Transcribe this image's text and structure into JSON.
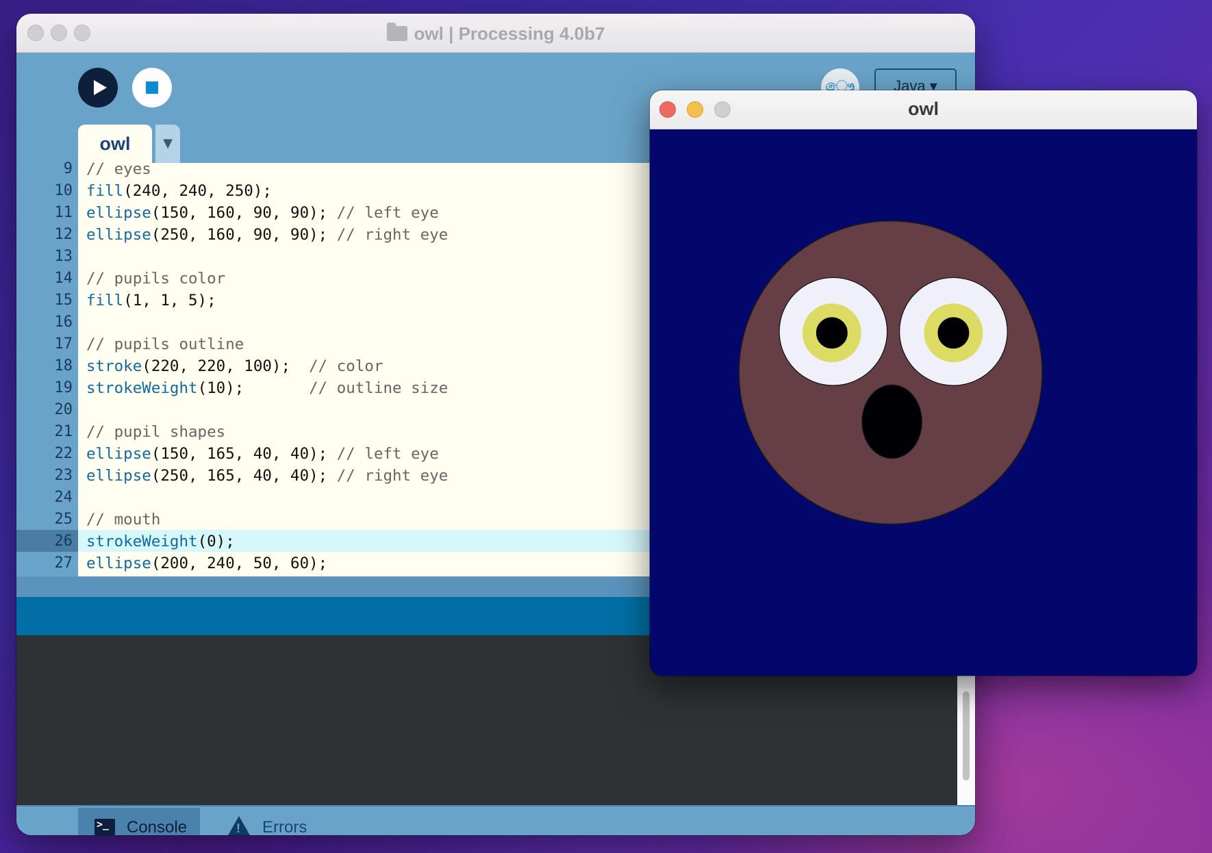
{
  "ide": {
    "title": "owl | Processing 4.0b7",
    "mode_icon": "ෞ",
    "mode_label": "Java ▾",
    "tab_label": "owl",
    "tab_menu_glyph": "▼",
    "lines": [
      {
        "n": "9",
        "tokens": [
          {
            "t": "// eyes",
            "k": "cm"
          }
        ]
      },
      {
        "n": "10",
        "tokens": [
          {
            "t": "fill",
            "k": "fn"
          },
          {
            "t": "(240, 240, 250);",
            "k": ""
          }
        ]
      },
      {
        "n": "11",
        "tokens": [
          {
            "t": "ellipse",
            "k": "fn"
          },
          {
            "t": "(150, 160, 90, 90); ",
            "k": ""
          },
          {
            "t": "// left eye",
            "k": "cm"
          }
        ]
      },
      {
        "n": "12",
        "tokens": [
          {
            "t": "ellipse",
            "k": "fn"
          },
          {
            "t": "(250, 160, 90, 90); ",
            "k": ""
          },
          {
            "t": "// right eye",
            "k": "cm"
          }
        ]
      },
      {
        "n": "13",
        "tokens": []
      },
      {
        "n": "14",
        "tokens": [
          {
            "t": "// pupils color",
            "k": "cm"
          }
        ]
      },
      {
        "n": "15",
        "tokens": [
          {
            "t": "fill",
            "k": "fn"
          },
          {
            "t": "(1, 1, 5);",
            "k": ""
          }
        ]
      },
      {
        "n": "16",
        "tokens": []
      },
      {
        "n": "17",
        "tokens": [
          {
            "t": "// pupils outline",
            "k": "cm"
          }
        ]
      },
      {
        "n": "18",
        "tokens": [
          {
            "t": "stroke",
            "k": "fn"
          },
          {
            "t": "(220, 220, 100);  ",
            "k": ""
          },
          {
            "t": "// color",
            "k": "cm"
          }
        ]
      },
      {
        "n": "19",
        "tokens": [
          {
            "t": "strokeWeight",
            "k": "fn"
          },
          {
            "t": "(10);       ",
            "k": ""
          },
          {
            "t": "// outline size",
            "k": "cm"
          }
        ]
      },
      {
        "n": "20",
        "tokens": []
      },
      {
        "n": "21",
        "tokens": [
          {
            "t": "// pupil shapes",
            "k": "cm"
          }
        ]
      },
      {
        "n": "22",
        "tokens": [
          {
            "t": "ellipse",
            "k": "fn"
          },
          {
            "t": "(150, 165, 40, 40); ",
            "k": ""
          },
          {
            "t": "// left eye",
            "k": "cm"
          }
        ]
      },
      {
        "n": "23",
        "tokens": [
          {
            "t": "ellipse",
            "k": "fn"
          },
          {
            "t": "(250, 165, 40, 40); ",
            "k": ""
          },
          {
            "t": "// right eye",
            "k": "cm"
          }
        ]
      },
      {
        "n": "24",
        "tokens": []
      },
      {
        "n": "25",
        "tokens": [
          {
            "t": "// mouth",
            "k": "cm"
          }
        ]
      },
      {
        "n": "26",
        "tokens": [
          {
            "t": "strokeWeight",
            "k": "fn"
          },
          {
            "t": "(0);",
            "k": ""
          }
        ],
        "highlight": true
      },
      {
        "n": "27",
        "tokens": [
          {
            "t": "ellipse",
            "k": "fn"
          },
          {
            "t": "(200, 240, 50, 60);",
            "k": ""
          }
        ]
      }
    ],
    "bottom_tabs": {
      "console": "Console",
      "errors": "Errors"
    }
  },
  "sketch": {
    "title": "owl",
    "background_color": "#03066a",
    "head_color": "#663e45",
    "eye_white_color": "#f0f0fa",
    "iris_color": "#dcdc64",
    "pupil_color": "#010105"
  },
  "colors": {
    "editor_bg": "#fffef0",
    "function_color": "#136a9e",
    "comment_color": "#666666",
    "highlight_line": "#d7f8fb",
    "accent": "#016fa5"
  }
}
